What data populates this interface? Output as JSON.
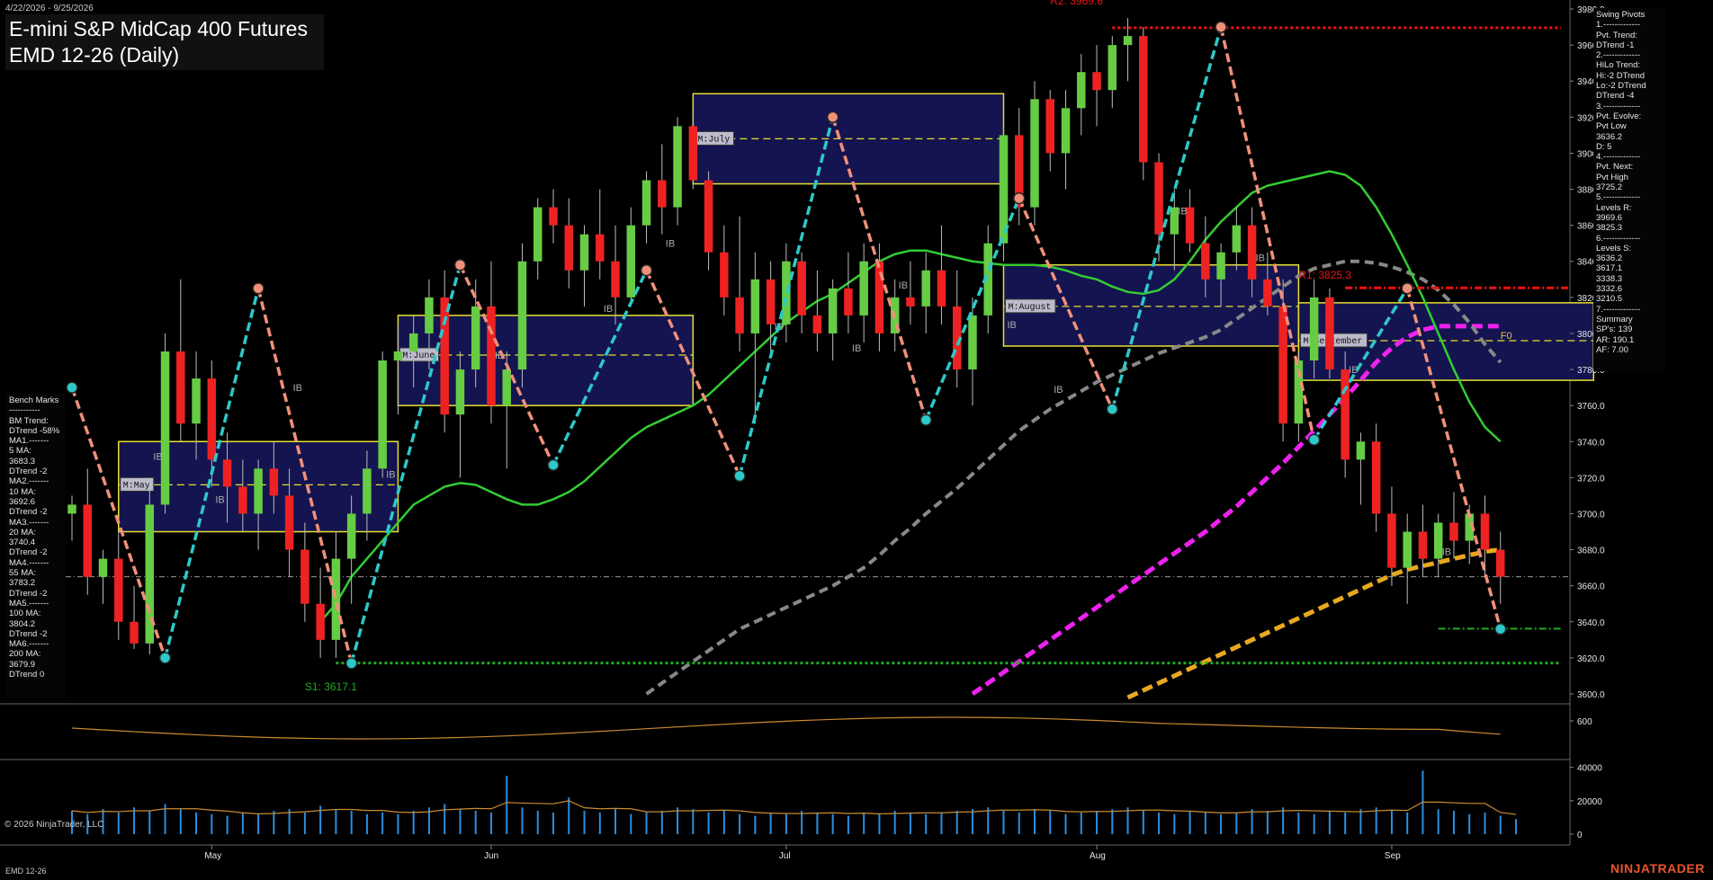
{
  "header": {
    "date_range": "4/22/2026 - 9/25/2026",
    "title_line1": "E-mini S&P MidCap 400 Futures",
    "title_line2": "EMD 12-26 (Daily)"
  },
  "swing_pivots_panel": [
    "Swing Pivots",
    "1.-------------",
    "Pvt. Trend:",
    "DTrend -1",
    "2.-------------",
    "HiLo Trend:",
    "Hi:-2 DTrend",
    "Lo:-2 DTrend",
    "DTrend -4",
    "3.-------------",
    "Pvt. Evolve:",
    "Pvt Low",
    "3636.2",
    "D: 5",
    "4.-------------",
    "Pvt. Next:",
    "Pvt High",
    "3725.2",
    "5.-------------",
    "Levels R:",
    "3969.6",
    "3825.3",
    "6.-------------",
    "Levels S:",
    "3636.2",
    "3617.1",
    "3338.3",
    "3332.6",
    "3210.5",
    "7.-------------",
    "Summary",
    "SP's: 139",
    "AR: 190.1",
    "AF: 7.00"
  ],
  "bench_marks_panel": [
    "Bench Marks",
    "-----------",
    "BM Trend:",
    "DTrend -58%",
    "MA1.-------",
    "5 MA:",
    "3683.3",
    "DTrend -2",
    "MA2.-------",
    "10 MA:",
    "3692.6",
    "DTrend -2",
    "MA3.-------",
    "20 MA:",
    "3740.4",
    "DTrend -2",
    "MA4.-------",
    "55 MA:",
    "3783.2",
    "DTrend -2",
    "MA5.-------",
    "100 MA:",
    "3804.2",
    "DTrend -2",
    "MA6.-------",
    "200 MA:",
    "3679.9",
    "DTrend 0"
  ],
  "footer": {
    "copyright": "© 2026 NinjaTrader, LLC",
    "instrument": "EMD 12-26",
    "brand": "NINJATRADER"
  },
  "colors": {
    "background": "#000000",
    "up_candle": "#66cc44",
    "down_candle": "#ee2222",
    "ma20": "#33cc33",
    "ma55": "#888888",
    "ma100": "#ee22ee",
    "ma200": "#e8a820",
    "swing_up": "#2ec8c8",
    "swing_down": "#f0907a",
    "resistance": "#ee1111",
    "support": "#22aa22",
    "vwap_box_fill": "#141450",
    "vwap_box_border": "#e8e030"
  },
  "chart_data": {
    "type": "candlestick",
    "price_axis": {
      "ylim": [
        3595,
        3985
      ],
      "ticks": [
        "3980.0",
        "3960.0",
        "3940.0",
        "3920.0",
        "3900.0",
        "3880.0",
        "3860.0",
        "3840.0",
        "3820.0",
        "3800.0",
        "3780.0",
        "3760.0",
        "3740.0",
        "3720.0",
        "3700.0",
        "3680.0",
        "3660.0",
        "3640.0",
        "3620.0",
        "3600.0"
      ],
      "tick_values": [
        3980,
        3960,
        3940,
        3920,
        3900,
        3880,
        3860,
        3840,
        3820,
        3800,
        3780,
        3760,
        3740,
        3720,
        3700,
        3680,
        3660,
        3640,
        3620,
        3600
      ]
    },
    "oscillator_axis": {
      "ticks": [
        "600"
      ]
    },
    "volume_axis": {
      "ticks": [
        "40000",
        "20000",
        "0"
      ],
      "tick_values": [
        40000,
        20000,
        0
      ],
      "ylim": [
        0,
        42000
      ]
    },
    "month_labels": [
      "May",
      "Jun",
      "Jul",
      "Aug",
      "Sep"
    ],
    "month_bar_index": [
      9,
      27,
      46,
      66,
      85
    ],
    "level_labels": {
      "r2": "R2: 3969.6",
      "r1": "R1: 3825.3",
      "s1": "S1: 3617.1"
    },
    "levels": {
      "r2": 3969.6,
      "r1": 3825.3,
      "s1": 3617.1,
      "s_low": 3636.2
    },
    "vwap_boxes": [
      {
        "label": "M:May",
        "start": 3,
        "end": 21,
        "top": 3740,
        "bottom": 3690,
        "mid": 3716
      },
      {
        "label": "M:June",
        "start": 21,
        "end": 40,
        "top": 3810,
        "bottom": 3760,
        "mid": 3788
      },
      {
        "label": "M:July",
        "start": 40,
        "end": 60,
        "top": 3933,
        "bottom": 3883,
        "mid": 3908
      },
      {
        "label": "M:August",
        "start": 60,
        "end": 79,
        "top": 3838,
        "bottom": 3793,
        "mid": 3815
      },
      {
        "label": "M:September",
        "start": 79,
        "end": 98,
        "top": 3817,
        "bottom": 3774,
        "mid": 3796
      }
    ],
    "ib_label": "IB",
    "f0_label": "F0",
    "candles": [
      [
        3700,
        3710,
        3685,
        3705
      ],
      [
        3705,
        3725,
        3655,
        3665
      ],
      [
        3665,
        3680,
        3650,
        3675
      ],
      [
        3675,
        3690,
        3630,
        3640
      ],
      [
        3640,
        3660,
        3625,
        3628
      ],
      [
        3628,
        3720,
        3622,
        3705
      ],
      [
        3705,
        3800,
        3700,
        3790
      ],
      [
        3790,
        3830,
        3740,
        3750
      ],
      [
        3750,
        3790,
        3730,
        3775
      ],
      [
        3775,
        3785,
        3715,
        3730
      ],
      [
        3730,
        3745,
        3695,
        3715
      ],
      [
        3715,
        3730,
        3690,
        3700
      ],
      [
        3700,
        3730,
        3680,
        3725
      ],
      [
        3725,
        3740,
        3700,
        3710
      ],
      [
        3710,
        3725,
        3665,
        3680
      ],
      [
        3680,
        3695,
        3640,
        3650
      ],
      [
        3650,
        3670,
        3620,
        3630
      ],
      [
        3630,
        3690,
        3620,
        3675
      ],
      [
        3675,
        3710,
        3650,
        3700
      ],
      [
        3700,
        3735,
        3685,
        3725
      ],
      [
        3725,
        3790,
        3720,
        3785
      ],
      [
        3785,
        3805,
        3755,
        3790
      ],
      [
        3790,
        3810,
        3770,
        3800
      ],
      [
        3800,
        3830,
        3780,
        3820
      ],
      [
        3820,
        3835,
        3745,
        3755
      ],
      [
        3755,
        3790,
        3720,
        3780
      ],
      [
        3780,
        3830,
        3770,
        3815
      ],
      [
        3815,
        3840,
        3750,
        3760
      ],
      [
        3760,
        3790,
        3725,
        3780
      ],
      [
        3780,
        3850,
        3770,
        3840
      ],
      [
        3840,
        3875,
        3830,
        3870
      ],
      [
        3870,
        3880,
        3850,
        3860
      ],
      [
        3860,
        3875,
        3825,
        3835
      ],
      [
        3835,
        3860,
        3815,
        3855
      ],
      [
        3855,
        3880,
        3830,
        3840
      ],
      [
        3840,
        3860,
        3805,
        3820
      ],
      [
        3820,
        3870,
        3815,
        3860
      ],
      [
        3860,
        3890,
        3850,
        3885
      ],
      [
        3885,
        3905,
        3855,
        3870
      ],
      [
        3870,
        3920,
        3860,
        3915
      ],
      [
        3915,
        3925,
        3880,
        3885
      ],
      [
        3885,
        3890,
        3835,
        3845
      ],
      [
        3845,
        3860,
        3810,
        3820
      ],
      [
        3820,
        3865,
        3790,
        3800
      ],
      [
        3800,
        3845,
        3750,
        3830
      ],
      [
        3830,
        3840,
        3790,
        3805
      ],
      [
        3805,
        3850,
        3795,
        3840
      ],
      [
        3840,
        3845,
        3800,
        3810
      ],
      [
        3810,
        3835,
        3790,
        3800
      ],
      [
        3800,
        3830,
        3785,
        3825
      ],
      [
        3825,
        3845,
        3800,
        3810
      ],
      [
        3810,
        3850,
        3795,
        3840
      ],
      [
        3840,
        3850,
        3790,
        3800
      ],
      [
        3800,
        3830,
        3790,
        3820
      ],
      [
        3820,
        3840,
        3805,
        3815
      ],
      [
        3815,
        3845,
        3800,
        3835
      ],
      [
        3835,
        3860,
        3805,
        3815
      ],
      [
        3815,
        3835,
        3770,
        3780
      ],
      [
        3780,
        3820,
        3760,
        3810
      ],
      [
        3810,
        3860,
        3800,
        3850
      ],
      [
        3850,
        3915,
        3840,
        3910
      ],
      [
        3910,
        3925,
        3860,
        3870
      ],
      [
        3870,
        3940,
        3860,
        3930
      ],
      [
        3930,
        3935,
        3890,
        3900
      ],
      [
        3900,
        3935,
        3880,
        3925
      ],
      [
        3925,
        3955,
        3910,
        3945
      ],
      [
        3945,
        3960,
        3915,
        3935
      ],
      [
        3935,
        3965,
        3925,
        3960
      ],
      [
        3960,
        3975,
        3940,
        3965
      ],
      [
        3965,
        3970,
        3885,
        3895
      ],
      [
        3895,
        3900,
        3840,
        3855
      ],
      [
        3855,
        3880,
        3835,
        3870
      ],
      [
        3870,
        3880,
        3845,
        3850
      ],
      [
        3850,
        3865,
        3820,
        3830
      ],
      [
        3830,
        3850,
        3815,
        3845
      ],
      [
        3845,
        3870,
        3835,
        3860
      ],
      [
        3860,
        3870,
        3820,
        3830
      ],
      [
        3830,
        3845,
        3810,
        3815
      ],
      [
        3815,
        3830,
        3740,
        3750
      ],
      [
        3750,
        3790,
        3740,
        3785
      ],
      [
        3785,
        3830,
        3775,
        3820
      ],
      [
        3820,
        3825,
        3775,
        3780
      ],
      [
        3780,
        3790,
        3720,
        3730
      ],
      [
        3730,
        3745,
        3705,
        3740
      ],
      [
        3740,
        3750,
        3690,
        3700
      ],
      [
        3700,
        3715,
        3660,
        3670
      ],
      [
        3670,
        3700,
        3650,
        3690
      ],
      [
        3690,
        3705,
        3665,
        3675
      ],
      [
        3675,
        3700,
        3665,
        3695
      ],
      [
        3695,
        3712,
        3675,
        3685
      ],
      [
        3685,
        3705,
        3672,
        3700
      ],
      [
        3700,
        3710,
        3665,
        3680
      ],
      [
        3680,
        3690,
        3650,
        3665
      ]
    ],
    "volumes": [
      14000,
      12000,
      15000,
      13000,
      16000,
      14000,
      18000,
      15000,
      13000,
      12000,
      11000,
      13000,
      12000,
      14000,
      15000,
      13000,
      17000,
      15000,
      14000,
      12000,
      13000,
      12000,
      14000,
      16000,
      18000,
      15000,
      14000,
      13000,
      35000,
      16000,
      14000,
      13000,
      22000,
      14000,
      13000,
      15000,
      12000,
      13000,
      14000,
      16000,
      15000,
      13000,
      14000,
      12000,
      11000,
      13000,
      12000,
      14000,
      13000,
      12000,
      11000,
      13000,
      12000,
      14000,
      13000,
      12000,
      13000,
      14000,
      15000,
      16000,
      14000,
      13000,
      15000,
      14000,
      12000,
      13000,
      14000,
      15000,
      16000,
      14000,
      13000,
      12000,
      14000,
      13000,
      12000,
      13000,
      15000,
      14000,
      16000,
      13000,
      12000,
      14000,
      13000,
      15000,
      16000,
      14000,
      13000,
      38000,
      15000,
      14000,
      12000,
      13000,
      11000,
      9000
    ],
    "ma20": [
      3640,
      3650,
      3665,
      3675,
      3685,
      3695,
      3705,
      3710,
      3715,
      3717,
      3716,
      3712,
      3708,
      3705,
      3705,
      3708,
      3712,
      3718,
      3726,
      3734,
      3742,
      3748,
      3752,
      3756,
      3760,
      3766,
      3774,
      3782,
      3790,
      3798,
      3806,
      3812,
      3818,
      3822,
      3828,
      3834,
      3840,
      3844,
      3846,
      3846,
      3844,
      3842,
      3840,
      3839,
      3838,
      3838,
      3838,
      3837,
      3835,
      3832,
      3830,
      3826,
      3823,
      3822,
      3824,
      3830,
      3840,
      3852,
      3862,
      3870,
      3878,
      3882,
      3884,
      3886,
      3888,
      3890,
      3888,
      3882,
      3870,
      3855,
      3838,
      3820,
      3800,
      3780,
      3762,
      3748,
      3740
    ],
    "ma55": [
      3600,
      3606,
      3612,
      3618,
      3624,
      3630,
      3636,
      3640,
      3644,
      3648,
      3652,
      3656,
      3660,
      3665,
      3670,
      3677,
      3685,
      3692,
      3700,
      3707,
      3714,
      3722,
      3730,
      3738,
      3746,
      3752,
      3758,
      3763,
      3768,
      3773,
      3777,
      3781,
      3785,
      3789,
      3792,
      3795,
      3798,
      3802,
      3808,
      3814,
      3820,
      3826,
      3832,
      3836,
      3838,
      3840,
      3840,
      3839,
      3837,
      3834,
      3830,
      3824,
      3816,
      3806,
      3794,
      3784
    ],
    "ma100": [
      3600,
      3606,
      3612,
      3618,
      3624,
      3630,
      3636,
      3642,
      3648,
      3654,
      3660,
      3666,
      3672,
      3678,
      3684,
      3690,
      3697,
      3704,
      3712,
      3720,
      3728,
      3737,
      3746,
      3755,
      3764,
      3774,
      3784,
      3792,
      3798,
      3802,
      3804,
      3804,
      3804,
      3804,
      3804
    ],
    "ma200": [
      3598,
      3602,
      3606,
      3610,
      3614,
      3618,
      3622,
      3626,
      3630,
      3634,
      3638,
      3642,
      3646,
      3650,
      3654,
      3658,
      3662,
      3666,
      3669,
      3671,
      3673,
      3675,
      3677,
      3679,
      3680
    ],
    "swing_points": [
      [
        0,
        3770
      ],
      [
        1,
        3620
      ],
      [
        2,
        3825
      ],
      [
        3,
        3617
      ],
      [
        4,
        3838
      ],
      [
        5,
        3727
      ],
      [
        6,
        3835
      ],
      [
        7,
        3721
      ],
      [
        8,
        3920
      ],
      [
        9,
        3752
      ],
      [
        10,
        3875
      ],
      [
        11,
        3758
      ],
      [
        12,
        3970
      ],
      [
        13,
        3741
      ],
      [
        14,
        3825
      ],
      [
        15,
        3636
      ]
    ]
  }
}
